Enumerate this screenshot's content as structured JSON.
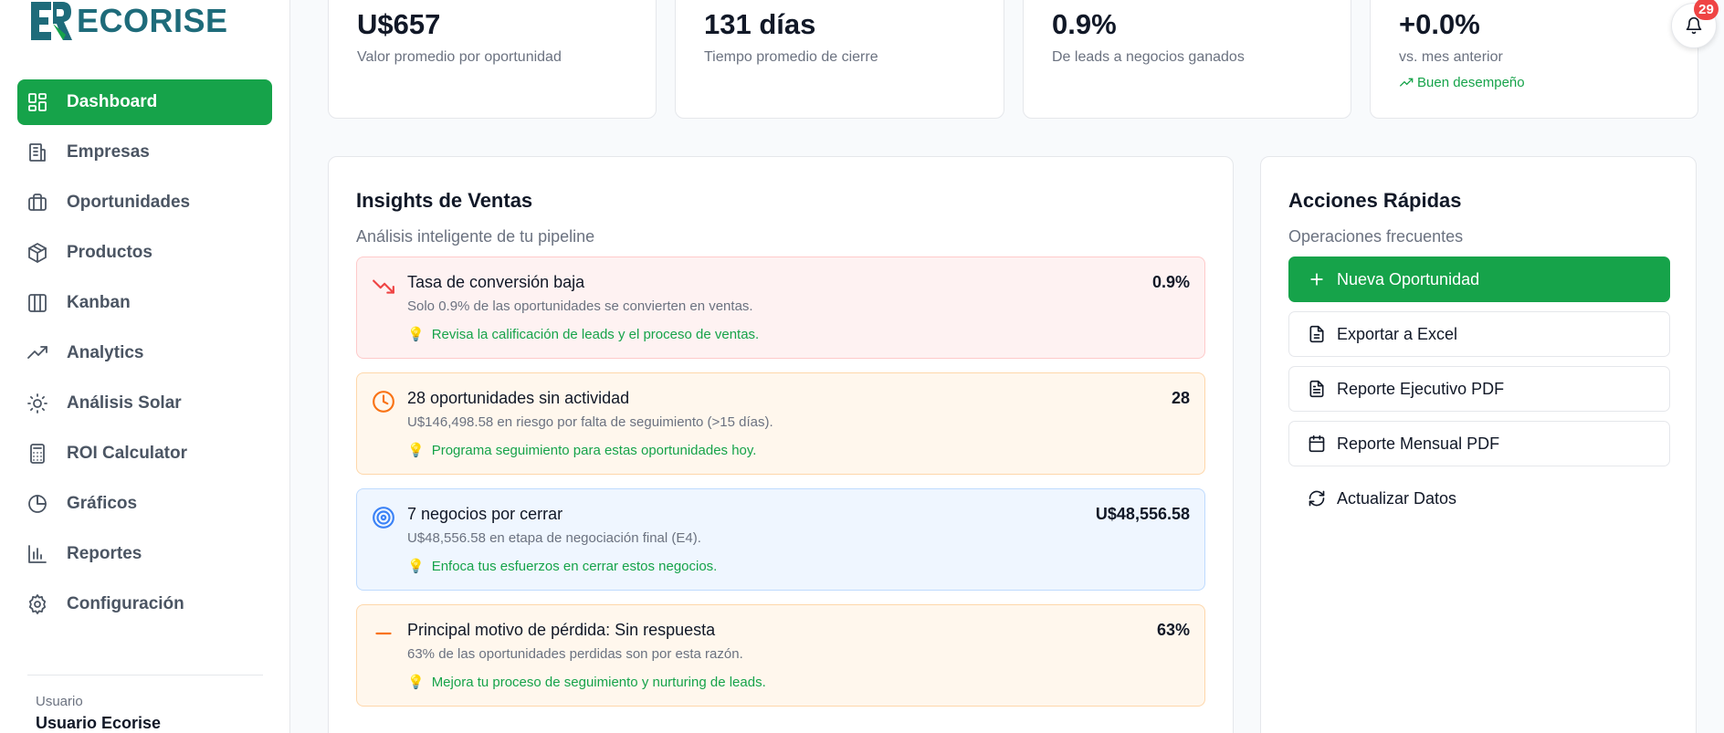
{
  "brand": {
    "name": "ECORISE",
    "accent": "#16a34a",
    "logo_color": "#1e6b7a"
  },
  "sidebar": {
    "items": [
      {
        "label": "Dashboard",
        "icon": "dashboard-grid-icon",
        "active": true
      },
      {
        "label": "Empresas",
        "icon": "building-icon"
      },
      {
        "label": "Oportunidades",
        "icon": "briefcase-icon"
      },
      {
        "label": "Productos",
        "icon": "package-icon"
      },
      {
        "label": "Kanban",
        "icon": "kanban-columns-icon"
      },
      {
        "label": "Analytics",
        "icon": "trending-up-icon"
      },
      {
        "label": "Análisis Solar",
        "icon": "sun-icon"
      },
      {
        "label": "ROI Calculator",
        "icon": "calculator-icon"
      },
      {
        "label": "Gráficos",
        "icon": "pie-chart-icon"
      },
      {
        "label": "Reportes",
        "icon": "bar-chart-icon"
      },
      {
        "label": "Configuración",
        "icon": "settings-gear-icon"
      }
    ],
    "user": {
      "role": "Usuario",
      "name": "Usuario Ecorise"
    }
  },
  "stats": [
    {
      "value": "U$657",
      "label": "Valor promedio por oportunidad"
    },
    {
      "value": "131 días",
      "label": "Tiempo promedio de cierre"
    },
    {
      "value": "0.9%",
      "label": "De leads a negocios ganados"
    },
    {
      "value": "+0.0%",
      "label": "vs. mes anterior",
      "trend": "Buen desempeño"
    }
  ],
  "notifications": {
    "count": "29"
  },
  "insights": {
    "title": "Insights de Ventas",
    "subtitle": "Análisis inteligente de tu pipeline",
    "items": [
      {
        "title": "Tasa de conversión baja",
        "value": "0.9%",
        "desc": "Solo 0.9% de las oportunidades se convierten en ventas.",
        "tip": "Revisa la calificación de leads y el proceso de ventas.",
        "icon": "trending-down-icon",
        "tone": "red"
      },
      {
        "title": "28 oportunidades sin actividad",
        "value": "28",
        "desc": "U$146,498.58 en riesgo por falta de seguimiento (>15 días).",
        "tip": "Programa seguimiento para estas oportunidades hoy.",
        "icon": "clock-icon",
        "tone": "orange"
      },
      {
        "title": "7 negocios por cerrar",
        "value": "U$48,556.58",
        "desc": "U$48,556.58 en etapa de negociación final (E4).",
        "tip": "Enfoca tus esfuerzos en cerrar estos negocios.",
        "icon": "target-icon",
        "tone": "blue"
      },
      {
        "title": "Principal motivo de pérdida: Sin respuesta",
        "value": "63%",
        "desc": "63% de las oportunidades perdidas son por esta razón.",
        "tip": "Mejora tu proceso de seguimiento y nurturing de leads.",
        "icon": "minus-icon",
        "tone": "orange"
      }
    ]
  },
  "quick_actions": {
    "title": "Acciones Rápidas",
    "subtitle": "Operaciones frecuentes",
    "buttons": [
      {
        "label": "Nueva Oportunidad",
        "icon": "plus-icon"
      },
      {
        "label": "Exportar a Excel",
        "icon": "file-icon"
      },
      {
        "label": "Reporte Ejecutivo PDF",
        "icon": "file-text-icon"
      },
      {
        "label": "Reporte Mensual PDF",
        "icon": "calendar-icon"
      },
      {
        "label": "Actualizar Datos",
        "icon": "refresh-icon"
      }
    ]
  }
}
